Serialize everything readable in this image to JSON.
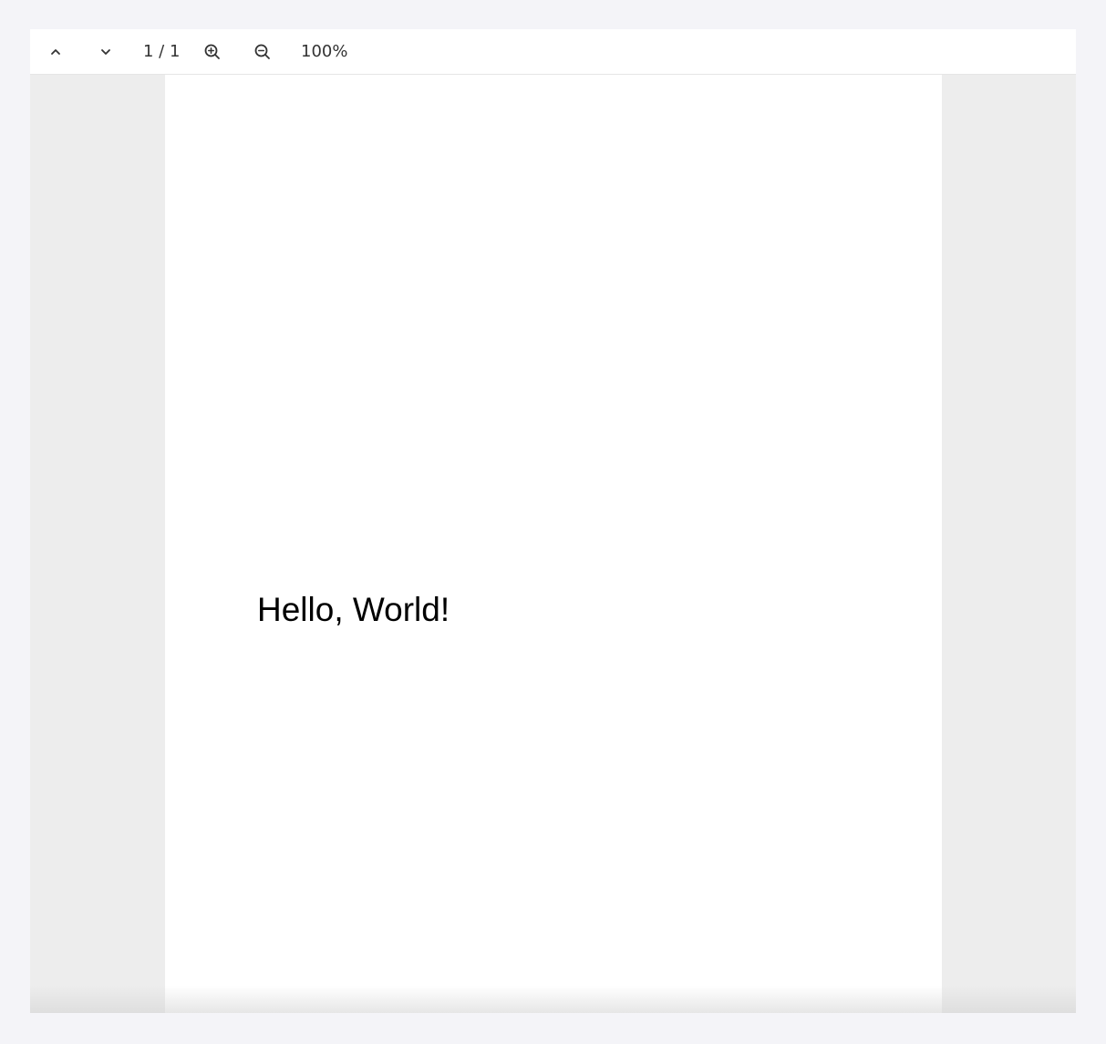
{
  "toolbar": {
    "prev_page_icon": "chevron-up-icon",
    "next_page_icon": "chevron-down-icon",
    "page_indicator": "1 / 1",
    "zoom_in_icon": "zoom-in-icon",
    "zoom_out_icon": "zoom-out-icon",
    "zoom_level": "100%"
  },
  "document": {
    "text": "Hello, World!"
  },
  "colors": {
    "frame_background": "#f4f4f8",
    "viewer_background": "#ededed",
    "page_background": "#ffffff",
    "toolbar_background": "#ffffff",
    "icon_color": "#333333"
  }
}
